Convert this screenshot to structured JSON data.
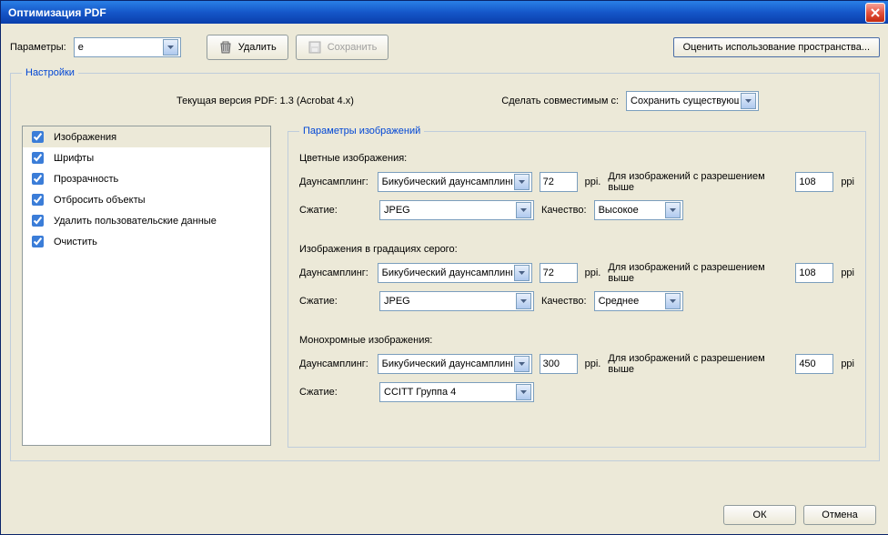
{
  "window": {
    "title": "Оптимизация PDF"
  },
  "toolbar": {
    "params_label": "Параметры:",
    "params_value": "e",
    "delete_label": "Удалить",
    "save_label": "Сохранить",
    "assess_label": "Оценить использование пространства..."
  },
  "settings": {
    "legend": "Настройки",
    "current_version_label": "Текущая версия PDF: 1.3 (Acrobat 4.x)",
    "compat_label": "Сделать совместимым с:",
    "compat_value": "Сохранить существующую"
  },
  "categories": [
    {
      "label": "Изображения",
      "checked": true,
      "selected": true
    },
    {
      "label": "Шрифты",
      "checked": true,
      "selected": false
    },
    {
      "label": "Прозрачность",
      "checked": true,
      "selected": false
    },
    {
      "label": "Отбросить объекты",
      "checked": true,
      "selected": false
    },
    {
      "label": "Удалить пользовательские данные",
      "checked": true,
      "selected": false
    },
    {
      "label": "Очистить",
      "checked": true,
      "selected": false
    }
  ],
  "imgparams": {
    "legend": "Параметры изображений",
    "labels": {
      "downsampling": "Даунсамплинг:",
      "compression": "Сжатие:",
      "quality": "Качество:",
      "ppi": "ppi.",
      "ppi_end": "ppi",
      "above": "Для изображений с разрешением выше"
    },
    "color": {
      "title": "Цветные изображения:",
      "downsampling": "Бикубический даунсамплинг",
      "ppi": "72",
      "above_ppi": "108",
      "compression": "JPEG",
      "quality": "Высокое"
    },
    "gray": {
      "title": "Изображения в градациях серого:",
      "downsampling": "Бикубический даунсамплинг",
      "ppi": "72",
      "above_ppi": "108",
      "compression": "JPEG",
      "quality": "Среднее"
    },
    "mono": {
      "title": "Монохромные изображения:",
      "downsampling": "Бикубический даунсамплинг",
      "ppi": "300",
      "above_ppi": "450",
      "compression": "CCITT Группа 4"
    }
  },
  "footer": {
    "ok": "ОК",
    "cancel": "Отмена"
  }
}
